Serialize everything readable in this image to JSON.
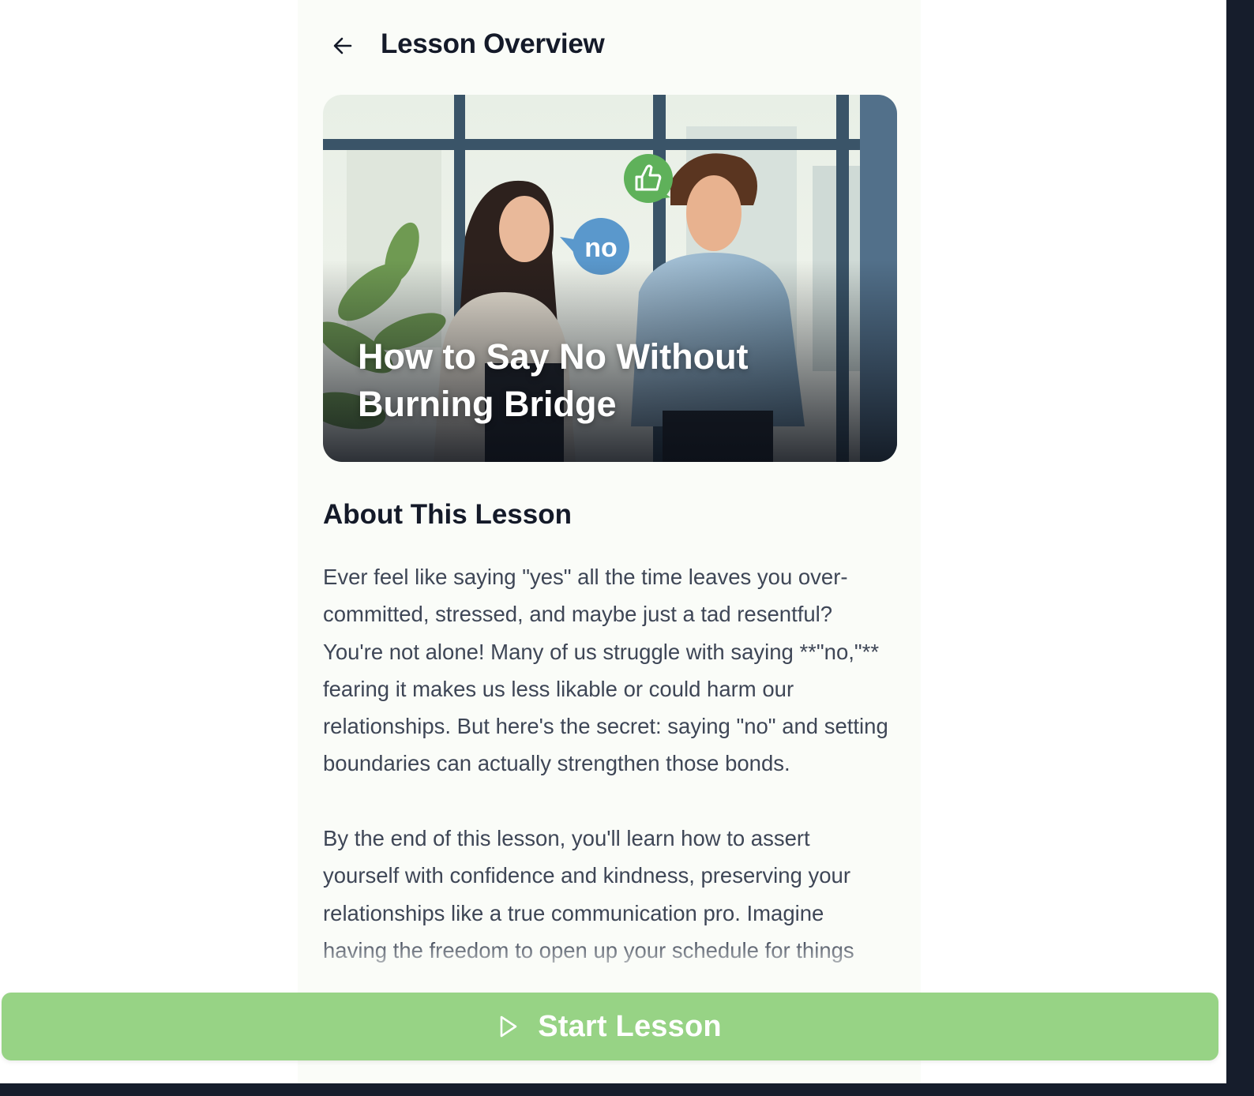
{
  "header": {
    "title": "Lesson Overview",
    "back_icon": "arrow-left-icon"
  },
  "hero": {
    "title": "How to Say No Without Burning Bridge",
    "bubble_text": "no",
    "thumbs_icon": "thumbs-up-icon"
  },
  "about": {
    "heading": "About This Lesson",
    "paragraph_1": "Ever feel like saying \"yes\" all the time leaves you over-committed, stressed, and maybe just a tad resentful? You're not alone! Many of us struggle with saying **\"no,\"** fearing it makes us less likable or could harm our relationships. But here's the secret: saying \"no\" and setting boundaries can actually strengthen those bonds.",
    "paragraph_2": "By the end of this lesson, you'll learn how to assert yourself with confidence and kindness, preserving your relationships like a true communication pro. Imagine having the freedom to open up your schedule for things"
  },
  "cta": {
    "label": "Start Lesson",
    "icon": "play-icon",
    "color": "#97d385"
  },
  "colors": {
    "frame": "#161d2c",
    "column_bg": "#fafcf8",
    "title_text": "#141a29",
    "body_text": "#3e4656"
  }
}
